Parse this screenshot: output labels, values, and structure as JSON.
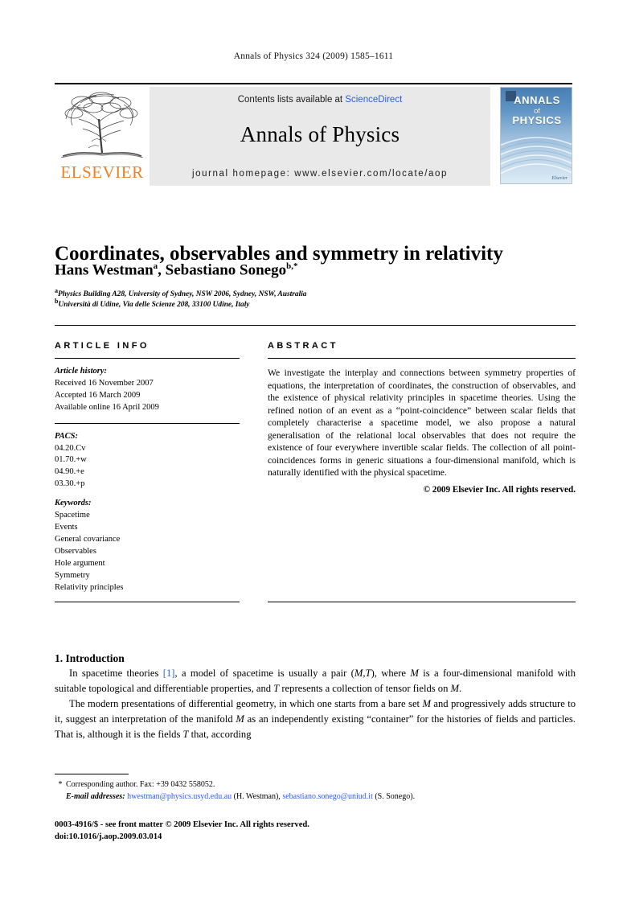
{
  "running_head": "Annals of Physics 324 (2009) 1585–1611",
  "masthead": {
    "contents_prefix": "Contents lists available at ",
    "sciencedirect": "ScienceDirect",
    "journal_title": "Annals of Physics",
    "homepage": "journal homepage: www.elsevier.com/locate/aop",
    "publisher_wordmark": "ELSEVIER",
    "cover": {
      "line1": "ANNALS",
      "line2": "of",
      "line3": "PHYSICS",
      "brand": "Elsevier"
    },
    "accent_blue": "#2b5fd9",
    "elsevier_orange": "#F08024",
    "panel_gray": "#e9e9e9"
  },
  "article": {
    "title": "Coordinates, observables and symmetry in relativity",
    "authors_html": "Hans Westman<sup>a</sup>, Sebastiano Sonego<sup>b,*</sup>",
    "affiliation_a": "Physics Building A28, University of Sydney, NSW 2006, Sydney, NSW, Australia",
    "affiliation_b": "Università di Udine, Via delle Scienze 208, 33100 Udine, Italy"
  },
  "info": {
    "heading": "ARTICLE INFO",
    "history_label": "Article history:",
    "history": [
      "Received 16 November 2007",
      "Accepted 16 March 2009",
      "Available online 16 April 2009"
    ],
    "pacs_label": "PACS:",
    "pacs": [
      "04.20.Cv",
      "01.70.+w",
      "04.90.+e",
      "03.30.+p"
    ],
    "keywords_label": "Keywords:",
    "keywords": [
      "Spacetime",
      "Events",
      "General covariance",
      "Observables",
      "Hole argument",
      "Symmetry",
      "Relativity principles"
    ]
  },
  "abstract": {
    "heading": "ABSTRACT",
    "text": "We investigate the interplay and connections between symmetry properties of equations, the interpretation of coordinates, the construction of observables, and the existence of physical relativity principles in spacetime theories. Using the refined notion of an event as a “point-coincidence” between scalar fields that completely characterise a spacetime model, we also propose a natural generalisation of the relational local observables that does not require the existence of four everywhere invertible scalar fields. The collection of all point-coincidences forms in generic situations a four-dimensional manifold, which is naturally identified with the physical spacetime.",
    "copyright": "© 2009 Elsevier Inc. All rights reserved."
  },
  "body": {
    "section_title": "1. Introduction",
    "paragraph1_html": "In spacetime theories <span class=\"cite\">[1]</span>, a model of spacetime is usually a pair (<i>M</i>,<i>T</i>), where <i>M</i> is a four-dimensional manifold with suitable topological and differentiable properties, and <i>T</i> represents a collection of tensor fields on <i>M</i>.",
    "paragraph2_html": "The modern presentations of differential geometry, in which one starts from a bare set <i>M</i> and progressively adds structure to it, suggest an interpretation of the manifold <i>M</i> as an independently existing “container” for the histories of fields and particles. That is, although it is the fields <i>T</i> that, according"
  },
  "footnotes": {
    "corresponding": "Corresponding author. Fax: +39 0432 558052.",
    "email_label": "E-mail addresses:",
    "email1": "hwestman@physics.usyd.edu.au",
    "email1_owner": "(H. Westman),",
    "email2": "sebastiano.sonego@uniud.it",
    "email2_owner": "(S. Sonego)."
  },
  "imprint": {
    "line1": "0003-4916/$ - see front matter © 2009 Elsevier Inc. All rights reserved.",
    "line2": "doi:10.1016/j.aop.2009.03.014"
  }
}
